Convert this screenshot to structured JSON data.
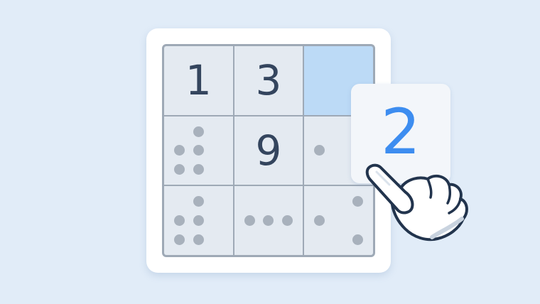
{
  "board": {
    "cells": [
      {
        "value": "1",
        "notes": []
      },
      {
        "value": "3",
        "notes": []
      },
      {
        "value": "",
        "notes": [],
        "highlighted": true
      },
      {
        "value": "",
        "notes": [
          2,
          4,
          5,
          7,
          8
        ]
      },
      {
        "value": "9",
        "notes": []
      },
      {
        "value": "",
        "notes": [
          3,
          4
        ]
      },
      {
        "value": "",
        "notes": [
          2,
          4,
          5,
          7,
          8
        ]
      },
      {
        "value": "",
        "notes": [
          4,
          5,
          6
        ]
      },
      {
        "value": "",
        "notes": [
          3,
          4,
          9
        ]
      }
    ]
  },
  "picker": {
    "digit": "2"
  },
  "icons": {
    "hand": "pointing-hand-icon"
  },
  "colors": {
    "background": "#e1ecf8",
    "highlight": "#bcdaf6",
    "digit": "#34455e",
    "picker_digit": "#3d8df0",
    "note_dot": "#a8b1bc"
  }
}
